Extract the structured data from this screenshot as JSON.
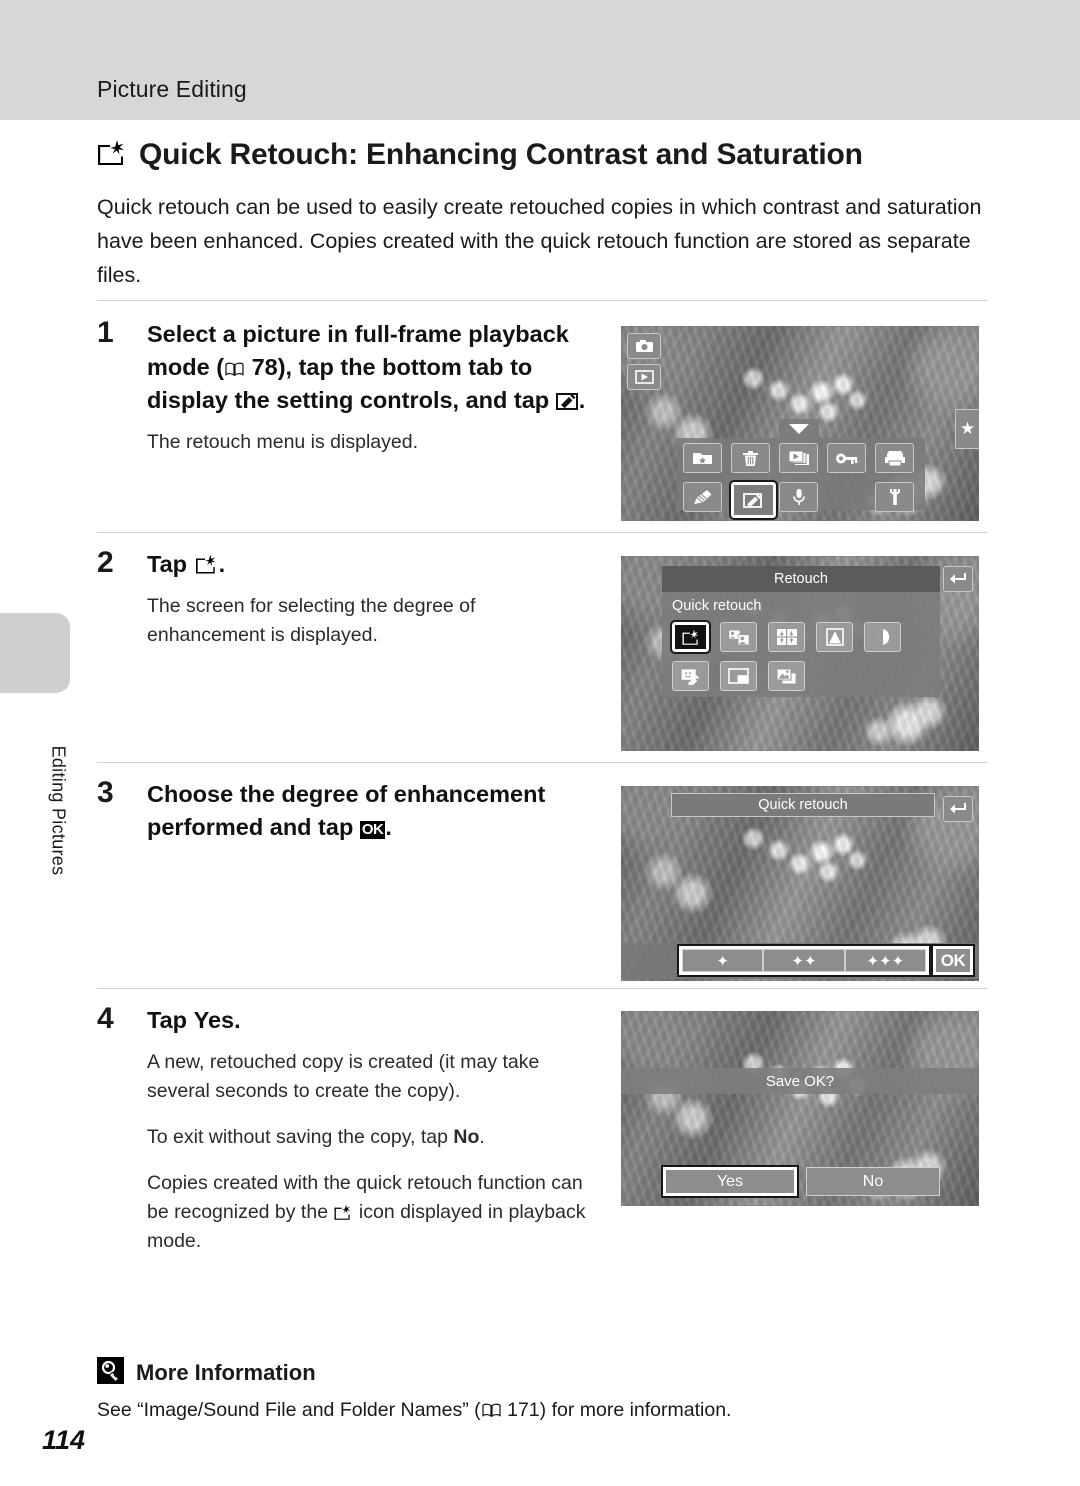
{
  "header": {
    "running_head": "Picture Editing"
  },
  "chapter": {
    "icon": "quick-retouch-icon",
    "title": "Quick Retouch: Enhancing Contrast and Saturation",
    "intro": "Quick retouch can be used to easily create retouched copies in which contrast and saturation have been enhanced. Copies created with the quick retouch function are stored as separate files."
  },
  "sidebar": {
    "chapter_label": "Editing Pictures"
  },
  "steps": [
    {
      "number": "1",
      "title_a": "Select a picture in full-frame playback mode (",
      "page_ref": "78",
      "title_b": "), tap the bottom tab to display the setting controls, and tap ",
      "title_c": ".",
      "notes": [
        "The retouch menu is displayed."
      ],
      "screen": {
        "name": "full-frame-playback-screen",
        "mode_icons": [
          "camera-icon",
          "playback-icon"
        ],
        "star_tab": "★",
        "toolbar_icons": [
          "favorites-folder-icon",
          "delete-trash-icon",
          "slideshow-icon",
          "protect-key-icon",
          "print-order-icon",
          "draw-pencil-icon",
          "retouch-icon",
          "voice-memo-icon",
          "setup-wrench-icon"
        ],
        "selected_icon": "retouch-icon"
      }
    },
    {
      "number": "2",
      "title_a": "Tap ",
      "title_c": ".",
      "notes": [
        "The screen for selecting the degree of enhancement is displayed."
      ],
      "screen": {
        "name": "retouch-menu-screen",
        "titlebar": "Retouch",
        "subtitle": "Quick retouch",
        "back_button": "back-icon",
        "menu_icons": [
          "quick-retouch-icon",
          "skin-softening-icon",
          "d-lighting-icon",
          "filter-effects-icon",
          "black-border-icon",
          "smart-portrait-icon",
          "small-picture-icon",
          "crop-icon"
        ],
        "selected_icon": "quick-retouch-icon"
      }
    },
    {
      "number": "3",
      "title_a": "Choose the degree of enhancement performed and tap ",
      "ok_label": "OK",
      "title_c": ".",
      "notes": [],
      "screen": {
        "name": "quick-retouch-level-screen",
        "title": "Quick retouch",
        "back_button": "back-icon",
        "levels": [
          "✦",
          "✦✦",
          "✦✦✦"
        ],
        "confirm_button": "OK"
      }
    },
    {
      "number": "4",
      "title_a": "Tap ",
      "title_bold": "Yes",
      "title_c": ".",
      "notes": [
        "A new, retouched copy is created (it may take several seconds to create the copy).",
        "To exit without saving the copy, tap ",
        "Copies created with the quick retouch function can be recognized by the "
      ],
      "note2_bold": "No",
      "note2_tail": ".",
      "note3_tail": " icon displayed in playback mode.",
      "screen": {
        "name": "save-confirm-screen",
        "prompt": "Save OK?",
        "yes_label": "Yes",
        "no_label": "No",
        "selected_button": "Yes"
      }
    }
  ],
  "more_information": {
    "icon": "more-information-icon",
    "heading": "More Information",
    "body_a": "See “Image/Sound File and Folder Names” (",
    "page_ref": "171",
    "body_b": ") for more information."
  },
  "footer": {
    "page_number": "114"
  },
  "colors": {
    "header_band": "#d7d7d7",
    "chapter_tab": "#cfcfcf",
    "divider": "#d2d2d2",
    "text": "#1a1a1a"
  }
}
